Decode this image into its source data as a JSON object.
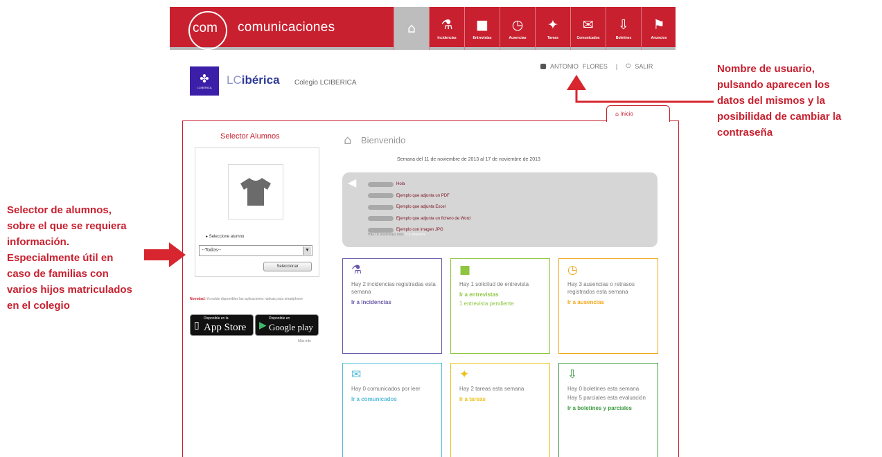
{
  "header": {
    "logo_mark": "com",
    "app_title": "comunicaciones",
    "nav": [
      {
        "label": "",
        "icon": "home-icon",
        "glyph": "⌂"
      },
      {
        "label": "Incidencias",
        "icon": "flask-icon",
        "glyph": "⚗"
      },
      {
        "label": "Entrevistas",
        "icon": "speech-bubble-icon",
        "glyph": "■"
      },
      {
        "label": "Ausencias",
        "icon": "clock-icon",
        "glyph": "◷"
      },
      {
        "label": "Tareas",
        "icon": "puzzle-icon",
        "glyph": "✦"
      },
      {
        "label": "Comunicados",
        "icon": "envelope-icon",
        "glyph": "✉"
      },
      {
        "label": "Boletines",
        "icon": "download-icon",
        "glyph": "⇩"
      },
      {
        "label": "Anuncios",
        "icon": "megaphone-icon",
        "glyph": "⚑"
      }
    ]
  },
  "school": {
    "logo_caption": "LCIBERICA",
    "brand_prefix": "LC",
    "brand_suffix": "ibérica",
    "name": "Colegio LCIBERICA"
  },
  "user": {
    "first_name": "ANTONIO",
    "last_name": "FLORES",
    "separator": "|",
    "logout_label": "SALIR"
  },
  "home_tab": {
    "label": "Inicio"
  },
  "student_selector": {
    "title": "Selector Alumnos",
    "caption": "Seleccione alumno",
    "dropdown_value": "--Todos--",
    "button_label": "Seleccionar"
  },
  "novedad": {
    "label": "Novedad:",
    "text": "Ya están disponibles las aplicaciones nativas para smartphone"
  },
  "stores": {
    "app_store_top": "Disponible en la",
    "app_store_name": "App Store",
    "google_top": "Disponible en",
    "google_name": "Google play",
    "more_info": "Más info"
  },
  "welcome": {
    "title": "Bienvenido",
    "week": "Semana del 11 de noviembre de 2013 al 17 de noviembre de 2013"
  },
  "announcements": {
    "items": [
      "Hola",
      "Ejemplo que adjunta un PDF",
      "Ejemplo que adjunta Excel",
      "Ejemplo que adjunta un fichero de Word",
      "Ejemplo con imagen JPG"
    ],
    "more_text": "Hay 16 anuncio(s) más.",
    "more_link": "Ir a anuncios"
  },
  "cards": [
    {
      "name": "incidencias",
      "icon": "flask-icon",
      "glyph": "⚗",
      "color": "#6a5aa8",
      "text": "Hay 2 incidencias registradas esta semana",
      "link": "Ir a incidencias",
      "sub": ""
    },
    {
      "name": "entrevistas",
      "icon": "speech-bubble-icon",
      "glyph": "■",
      "color": "#8ec63f",
      "text": "Hay 1 solicitud de entrevista",
      "link": "Ir a entrevistas",
      "sub": "1 entrevista pendiente"
    },
    {
      "name": "ausencias",
      "icon": "clock-icon",
      "glyph": "◷",
      "color": "#f0a81c",
      "text": "Hay 3 ausencias o retrasos registrados esta semana",
      "link": "Ir a ausencias",
      "sub": ""
    },
    {
      "name": "comunicados",
      "icon": "envelope-icon",
      "glyph": "✉",
      "color": "#55bcd9",
      "text": "Hay 0 comunicados por leer",
      "link": "Ir a comunicados",
      "sub": ""
    },
    {
      "name": "tareas",
      "icon": "puzzle-icon",
      "glyph": "✦",
      "color": "#e9c21a",
      "text": "Hay 2 tareas esta semana",
      "link": "Ir a tareas",
      "sub": ""
    },
    {
      "name": "boletines",
      "icon": "download-icon",
      "glyph": "⇩",
      "color": "#3d9b40",
      "text": "Hay 0 boletines esta semana",
      "link": "Ir a boletines y parciales",
      "sub": "",
      "extra": "Hay 5 parciales esta evaluación"
    }
  ],
  "notes": {
    "left": [
      "Selector de alumnos,",
      "sobre el que se requiera",
      "información.",
      "Especialmente útil en",
      "caso de familias con",
      "varios hijos matriculados",
      "en el colegio"
    ],
    "right": [
      "Nombre de usuario,",
      "pulsando aparecen los",
      "datos del mismos y la",
      "posibilidad de cambiar la",
      "contraseña"
    ]
  },
  "colors": {
    "brand_red": "#c8202f",
    "active_nav": "#bdbdbd",
    "announcement_bg": "#d6d6d6"
  }
}
